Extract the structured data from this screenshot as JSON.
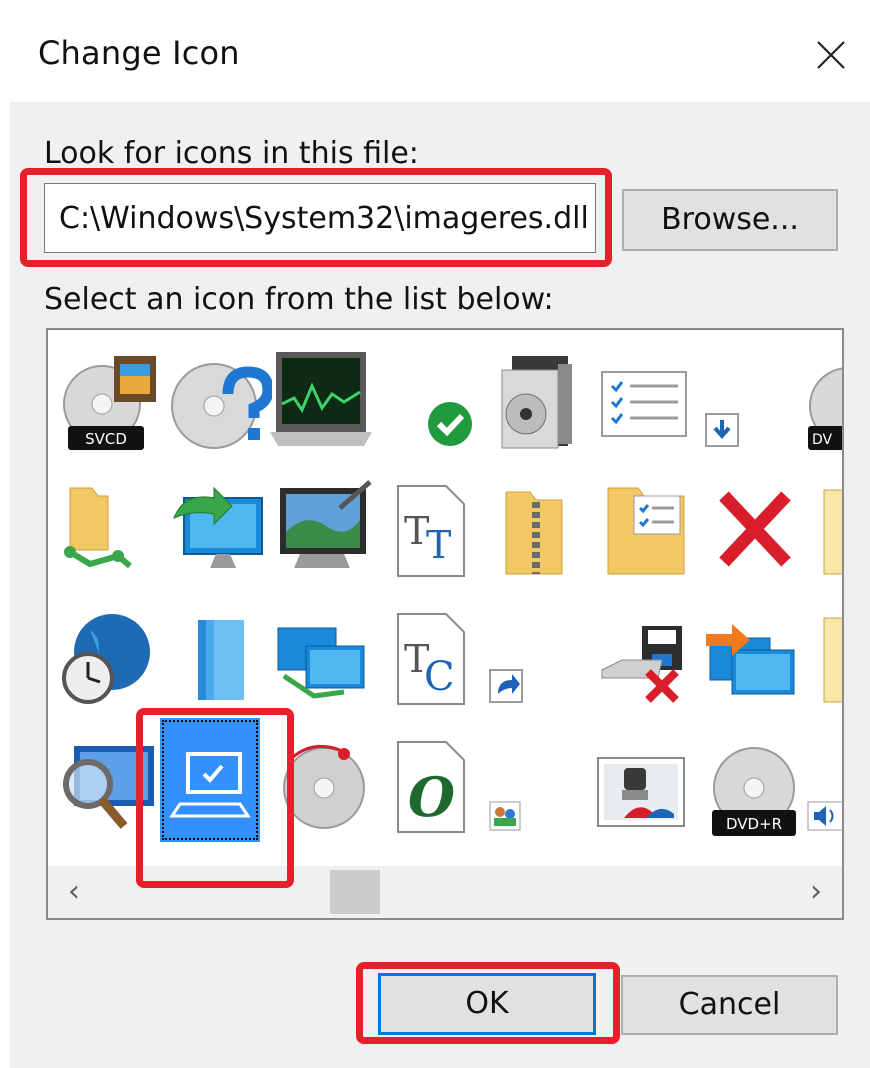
{
  "dialog": {
    "title": "Change Icon",
    "close_symbol": "✕"
  },
  "file_section": {
    "label": "Look for icons in this file:",
    "path_value": "C:\\Windows\\System32\\imageres.dll",
    "browse_label": "Browse..."
  },
  "icon_list": {
    "label": "Select an icon from the list below:",
    "selected_icon": "computer-monitor-check-icon",
    "icons": [
      "svcd-disc-icon",
      "disc-question-icon",
      "system-monitor-icon",
      "green-check-icon",
      "media-player-icon",
      "checklist-icon",
      "download-arrow-icon",
      "dvd-disc-icon",
      "network-folder-icon",
      "computer-restore-icon",
      "display-settings-icon",
      "font-tt-icon",
      "zip-folder-icon",
      "task-folder-icon",
      "red-x-icon",
      "folder-edge-icon",
      "globe-clock-icon",
      "stacked-books-icon",
      "network-computers-icon",
      "font-tc-icon",
      "shortcut-arrow-icon",
      "drive-remove-icon",
      "remote-computer-icon",
      "folder-edge-icon",
      "magnifier-computer-icon",
      "computer-monitor-check-icon",
      "disc-red-icon",
      "opentype-font-icon",
      "users-small-icon",
      "scanner-picture-icon",
      "dvd-r-disc-icon",
      "speaker-icon"
    ],
    "badges": {
      "svcd": "SVCD",
      "dvd": "DV",
      "dvdr": "DVD+R",
      "tt": "T",
      "tc": "T",
      "tc2": "C",
      "o": "O"
    },
    "scroll_left_symbol": "‹",
    "scroll_right_symbol": "›"
  },
  "actions": {
    "ok_label": "OK",
    "cancel_label": "Cancel"
  },
  "colors": {
    "highlight": "#e5202a",
    "selection": "#3390ff",
    "focus": "#0078d7"
  }
}
